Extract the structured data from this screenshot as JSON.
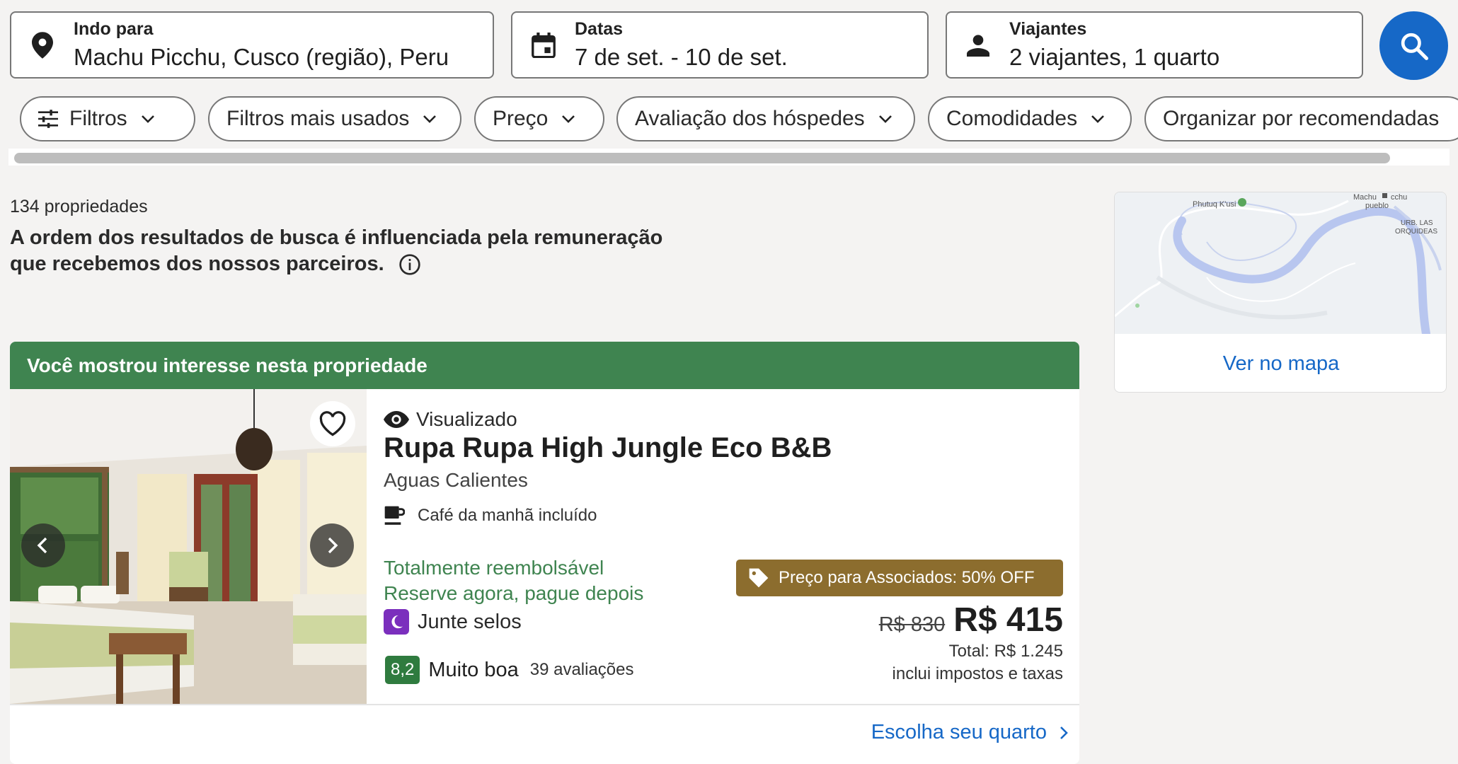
{
  "search": {
    "destination": {
      "label": "Indo para",
      "value": "Machu Picchu, Cusco (região), Peru",
      "icon": "location-pin-icon"
    },
    "dates": {
      "label": "Datas",
      "value": "7 de set. - 10 de set.",
      "icon": "calendar-icon"
    },
    "travelers": {
      "label": "Viajantes",
      "value": "2 viajantes, 1 quarto",
      "icon": "person-icon"
    },
    "button_icon": "search-icon",
    "accent_color": "#1668c7"
  },
  "filters": [
    {
      "label": "Filtros"
    },
    {
      "label": "Filtros mais usados"
    },
    {
      "label": "Preço"
    },
    {
      "label": "Avaliação dos hóspedes"
    },
    {
      "label": "Comodidades"
    },
    {
      "label": "Organizar por recomendadas"
    }
  ],
  "results": {
    "count": "134 propriedades",
    "disclaimer": "A ordem dos resultados de busca é influenciada pela remuneração que recebemos dos nossos parceiros."
  },
  "map": {
    "link": "Ver no mapa",
    "labels": {
      "poi": "Phutuq K'usi",
      "town_1": "Machu",
      "town_2": "cchu",
      "town_3": "pueblo",
      "district_1": "URB. LAS",
      "district_2": "ORQUIDEAS"
    }
  },
  "property": {
    "banner": "Você mostrou interesse nesta propriedade",
    "banner_color": "#3f8450",
    "viewed": "Visualizado",
    "name": "Rupa Rupa High Jungle Eco B&B",
    "location": "Aguas Calientes",
    "amenity": "Café da manhã incluído",
    "refund_1": "Totalmente reembolsável",
    "refund_2": "Reserve agora, pague depois",
    "stamps": "Junte selos",
    "score": "8,2",
    "rating_label": "Muito boa",
    "reviews": "39 avaliações",
    "deal": "Preço para Associados: 50% OFF",
    "deal_color": "#8c6d2e",
    "old_price": "R$ 830",
    "price": "R$ 415",
    "total": "Total: R$ 1.245",
    "taxes": "inclui impostos e taxas",
    "cta": "Escolha seu quarto"
  }
}
